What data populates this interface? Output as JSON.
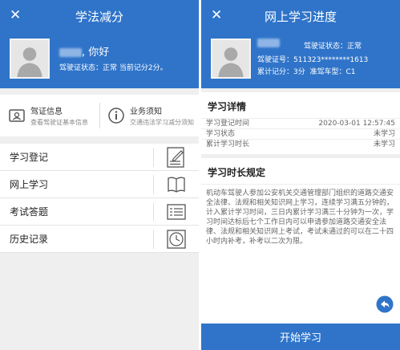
{
  "left": {
    "title": "学法减分",
    "close_glyph": "✕",
    "greeting": ", 你好",
    "status_label": "驾驶证状态：",
    "status_value": "正常",
    "score_text": "当前记分2分。",
    "info": [
      {
        "title": "驾证信息",
        "subtitle": "查看驾驶证基本信息",
        "icon": "id-card-icon"
      },
      {
        "title": "业务须知",
        "subtitle": "交通违法学习减分须知",
        "icon": "info-icon"
      }
    ],
    "menu": [
      {
        "label": "学习登记",
        "icon": "register-form-icon"
      },
      {
        "label": "网上学习",
        "icon": "book-icon"
      },
      {
        "label": "考试答题",
        "icon": "exam-list-icon"
      },
      {
        "label": "历史记录",
        "icon": "clock-icon"
      }
    ]
  },
  "right": {
    "title": "网上学习进度",
    "close_glyph": "✕",
    "license_status_label": "驾驶证状态：",
    "license_status_value": "正常",
    "license_no_label": "驾驶证号：",
    "license_no_value": "511323********1613",
    "points_label": "累计记分：",
    "points_value": "3分",
    "vehicle_label": "准驾车型：",
    "vehicle_value": "C1",
    "detail_title": "学习详情",
    "details": [
      {
        "label": "学习登记时间",
        "value": "2020-03-01 12:57:45"
      },
      {
        "label": "学习状态",
        "value": "未学习"
      },
      {
        "label": "累计学习时长",
        "value": "未学习"
      }
    ],
    "rules_title": "学习时长规定",
    "rules_text": "机动车驾驶人参加公安机关交通管理部门组织的道路交通安全法律、法规和相关知识网上学习，连续学习满五分钟的，计入累计学习时间，三日内累计学习满三十分钟为一次，学习时间达标后七个工作日内可以申请参加道路交通安全法律、法规和相关知识网上考试，考试未通过的可以在二十四小时内补考，补考以二次为限。",
    "start_button": "开始学习"
  },
  "colors": {
    "brand": "#2f74c9",
    "background": "#efefef"
  }
}
